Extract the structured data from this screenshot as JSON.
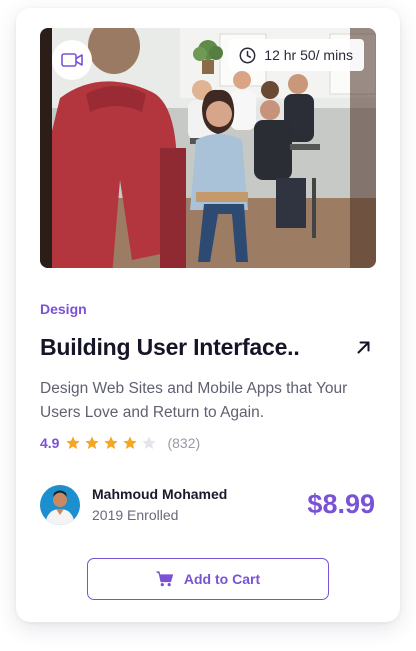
{
  "course": {
    "duration": "12 hr 50/ mins",
    "category": "Design",
    "title": "Building User Interface..",
    "description": "Design Web Sites and Mobile Apps that Your Users Love and Return to Again.",
    "rating": {
      "score": "4.9",
      "stars_filled": 4,
      "stars_total": 5,
      "count": "(832)"
    },
    "instructor": {
      "name": "Mahmoud Mohamed",
      "subtitle": "2019 Enrolled"
    },
    "price": "$8.99",
    "add_to_cart_label": "Add to Cart"
  },
  "icons": {
    "video": "video-camera-icon",
    "clock": "clock-icon",
    "arrow": "arrow-up-right-icon",
    "star": "star-icon",
    "cart": "cart-icon"
  },
  "colors": {
    "accent": "#7a52d6",
    "star_filled": "#f5a623",
    "star_empty": "#e4e4ea",
    "title": "#151527"
  }
}
